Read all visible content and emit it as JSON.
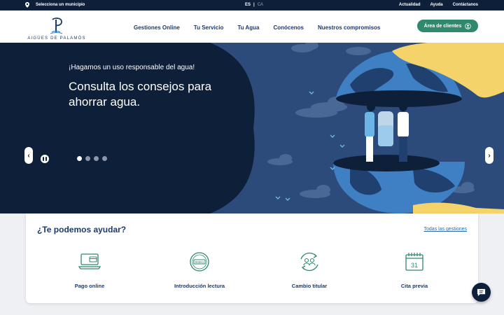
{
  "topbar": {
    "location_label": "Selecciona un municipio",
    "lang_active": "ES",
    "lang_separator": "|",
    "lang_inactive": "CA",
    "links": [
      "Actualidad",
      "Ayuda",
      "Contáctanos"
    ]
  },
  "header": {
    "logo_text": "AIGÜES DE PALAMÓS",
    "nav": [
      "Gestiones Online",
      "Tu Servicio",
      "Tu Agua",
      "Conócenos",
      "Nuestros compromisos"
    ],
    "client_button": "Área de clientes"
  },
  "hero": {
    "subtitle": "¡Hagamos un uso responsable del agua!",
    "title": "Consulta los consejos para ahorrar agua.",
    "prev_arrow": "‹",
    "next_arrow": "›",
    "slides_count": 4,
    "active_slide": 1
  },
  "help": {
    "heading": "¿Te podemos ayudar?",
    "all_link": "Todas las gestiones",
    "services": [
      {
        "label": "Pago online",
        "icon": "laptop-card-icon"
      },
      {
        "label": "Introducción lectura",
        "icon": "meter-icon"
      },
      {
        "label": "Cambio titular",
        "icon": "users-exchange-icon"
      },
      {
        "label": "Cita previa",
        "icon": "calendar-icon",
        "icon_text": "31"
      }
    ]
  },
  "meter_digits": "00001",
  "colors": {
    "topbar": "#0e1f3a",
    "brand": "#1d3a6b",
    "accent_green": "#2e8a6b",
    "hero_bg": "#2c4b7a"
  }
}
